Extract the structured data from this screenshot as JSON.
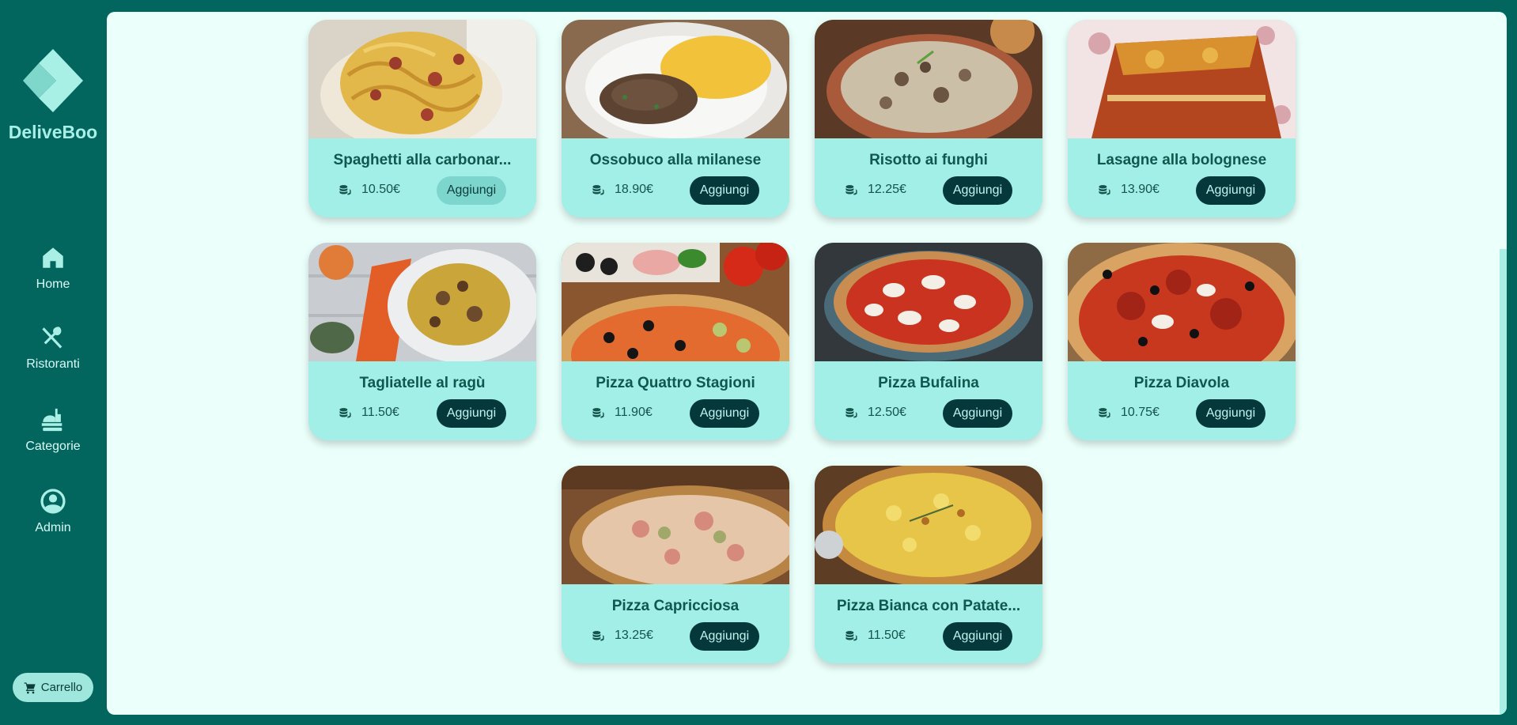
{
  "brand": {
    "name": "DeliveBoo"
  },
  "nav": [
    {
      "label": "Home",
      "icon": "home-icon"
    },
    {
      "label": "Ristoranti",
      "icon": "fork-knife-icon"
    },
    {
      "label": "Categorie",
      "icon": "food-category-icon"
    },
    {
      "label": "Admin",
      "icon": "user-circle-icon"
    }
  ],
  "cart": {
    "label": "Carrello",
    "icon": "cart-icon"
  },
  "add_label": "Aggiungi",
  "products": [
    {
      "name": "Spaghetti alla carbonar...",
      "price": "10.50€",
      "image": "spaghetti-carbonara"
    },
    {
      "name": "Ossobuco alla milanese",
      "price": "18.90€",
      "image": "ossobuco"
    },
    {
      "name": "Risotto ai funghi",
      "price": "12.25€",
      "image": "risotto"
    },
    {
      "name": "Lasagne alla bolognese",
      "price": "13.90€",
      "image": "lasagne"
    },
    {
      "name": "Tagliatelle al ragù",
      "price": "11.50€",
      "image": "tagliatelle"
    },
    {
      "name": "Pizza Quattro Stagioni",
      "price": "11.90€",
      "image": "pizza-quattro-stagioni"
    },
    {
      "name": "Pizza Bufalina",
      "price": "12.50€",
      "image": "pizza-bufalina"
    },
    {
      "name": "Pizza Diavola",
      "price": "10.75€",
      "image": "pizza-diavola"
    },
    {
      "name": "Pizza Capricciosa",
      "price": "13.25€",
      "image": "pizza-capricciosa"
    },
    {
      "name": "Pizza Bianca con Patate...",
      "price": "11.50€",
      "image": "pizza-bianca-patate"
    }
  ],
  "colors": {
    "sidebar": "#03665e",
    "panel": "#ebfffb",
    "card": "#a1efe6",
    "button": "#05383b"
  }
}
